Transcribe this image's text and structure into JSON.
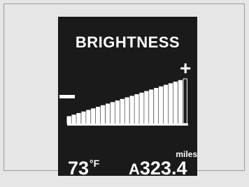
{
  "screen": {
    "title": "BRIGHTNESS",
    "increase_symbol": "+",
    "decrease_symbol": "−",
    "brightness_level": 0.95
  },
  "status": {
    "temperature": "73",
    "temperature_unit": "°F",
    "trip_indicator": "A",
    "odometer": "323.4",
    "odometer_unit": "miles"
  },
  "colors": {
    "screen_background": "#1a1a1a",
    "foreground": "#ffffff",
    "frame_background": "#e6e6e6"
  }
}
